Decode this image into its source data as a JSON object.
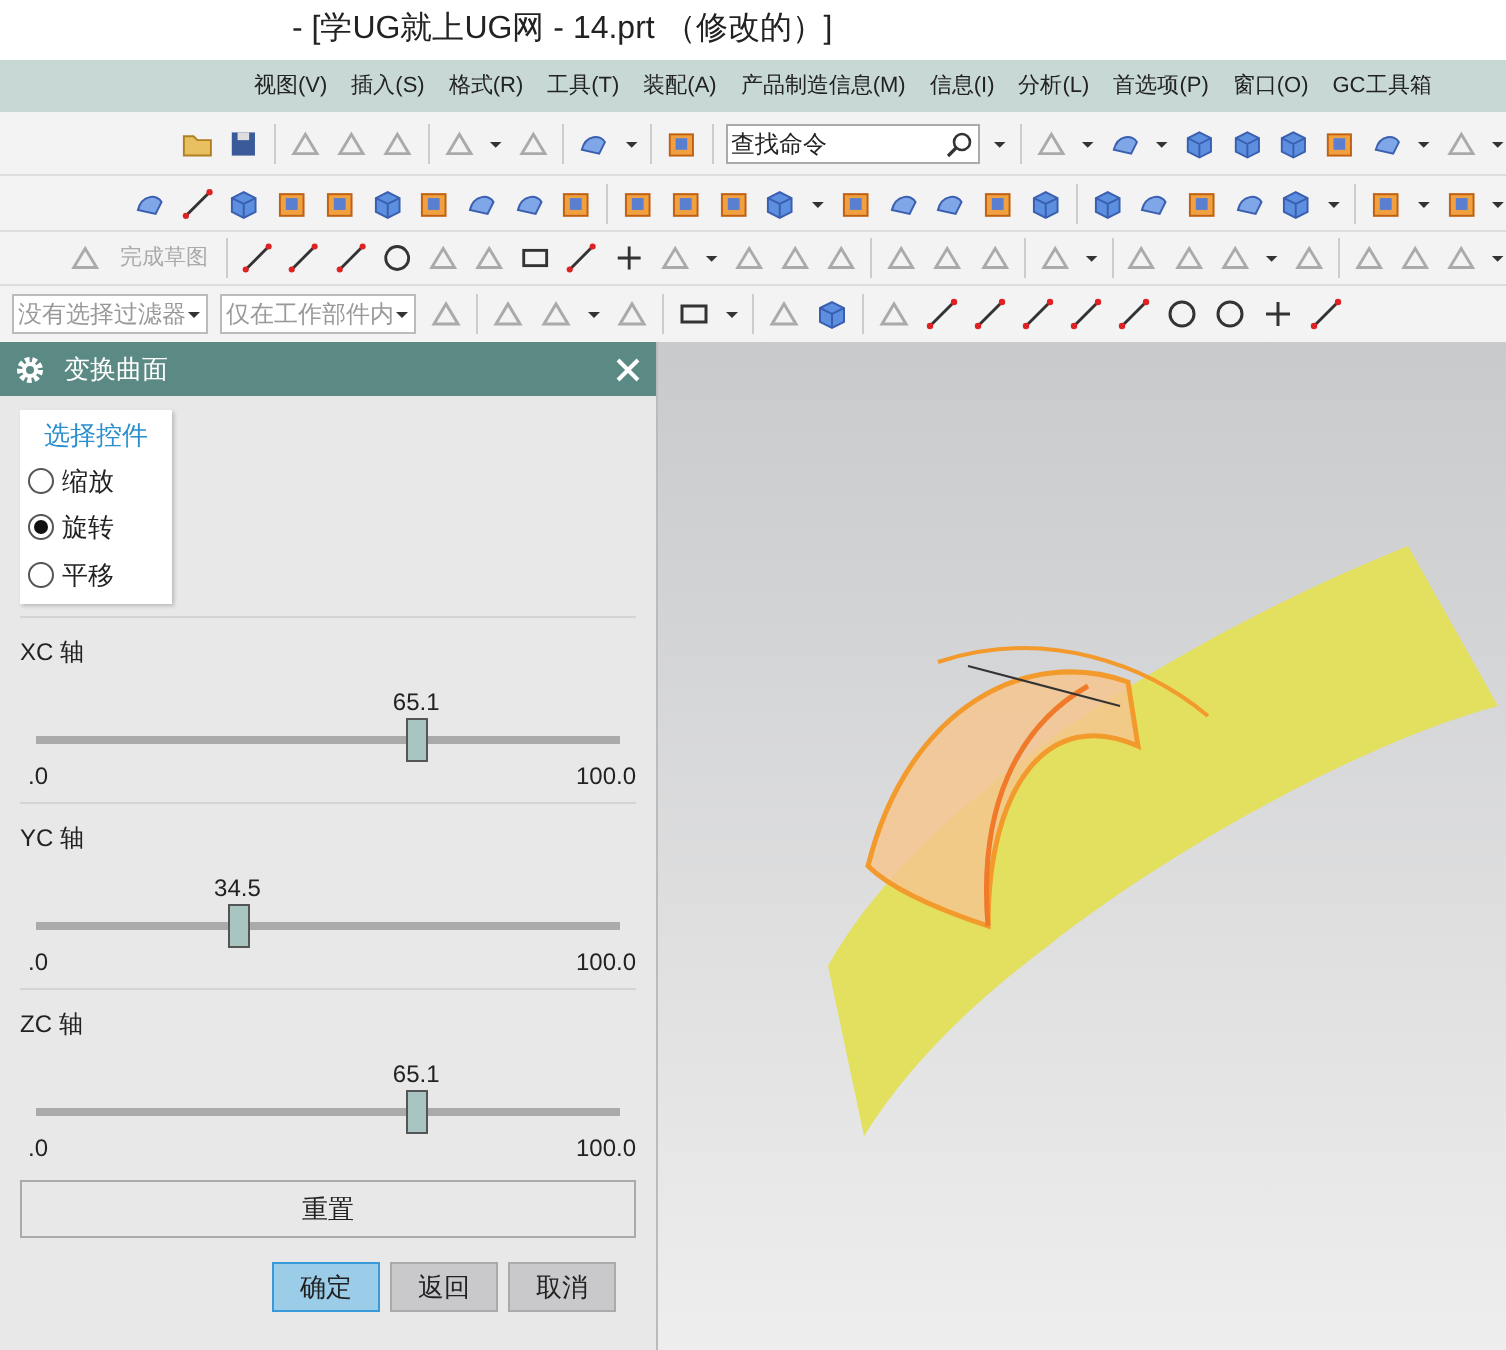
{
  "window": {
    "title": "- [学UG就上UG网 - 14.prt （修改的）]"
  },
  "menu": [
    "视图(V)",
    "插入(S)",
    "格式(R)",
    "工具(T)",
    "装配(A)",
    "产品制造信息(M)",
    "信息(I)",
    "分析(L)",
    "首选项(P)",
    "窗口(O)",
    "GC工具箱"
  ],
  "toolbar": {
    "search": {
      "value": "查找命令"
    },
    "sketch_button": {
      "label": "完成草图",
      "disabled": true
    },
    "filters": [
      {
        "value": "没有选择过滤器",
        "disabled": true
      },
      {
        "value": "仅在工作部件内",
        "disabled": true
      }
    ]
  },
  "dialog": {
    "title": "变换曲面",
    "group": {
      "title": "选择控件",
      "options": [
        {
          "label": "缩放",
          "selected": false
        },
        {
          "label": "旋转",
          "selected": true
        },
        {
          "label": "平移",
          "selected": false
        }
      ]
    },
    "sliders": [
      {
        "label": "XC 轴",
        "reading": "65.1",
        "level": 0.651,
        "min": ".0",
        "max": "100.0"
      },
      {
        "label": "YC 轴",
        "reading": "34.5",
        "level": 0.345,
        "min": ".0",
        "max": "100.0"
      },
      {
        "label": "ZC 轴",
        "reading": "65.1",
        "level": 0.651,
        "min": ".0",
        "max": "100.0"
      }
    ],
    "reset": "重置",
    "buttons": [
      {
        "label": "确定",
        "kind": "default"
      },
      {
        "label": "返回",
        "kind": "normal"
      },
      {
        "label": "取消",
        "kind": "normal"
      }
    ]
  }
}
